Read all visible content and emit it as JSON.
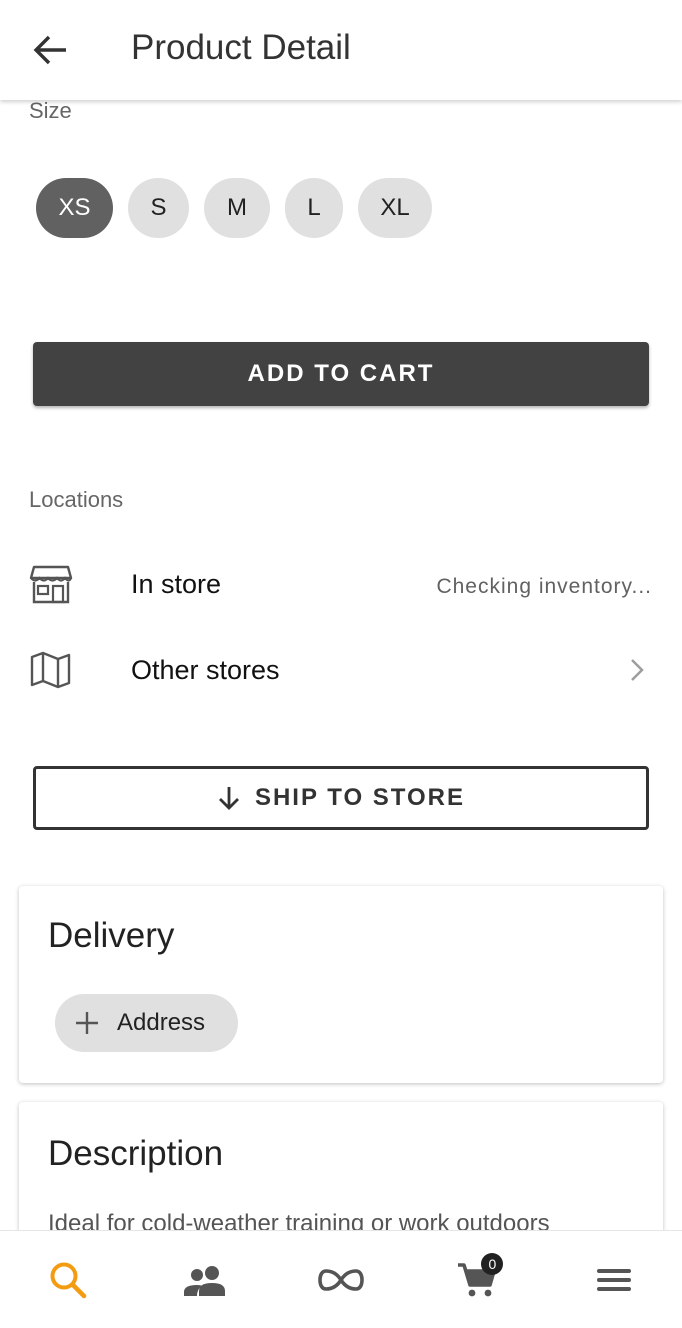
{
  "header": {
    "title": "Product Detail"
  },
  "size": {
    "label": "Size",
    "options": [
      "XS",
      "S",
      "M",
      "L",
      "XL"
    ],
    "selected": "XS"
  },
  "actions": {
    "add_to_cart": "ADD TO CART",
    "ship_to_store": "SHIP TO STORE"
  },
  "locations": {
    "label": "Locations",
    "in_store": {
      "title": "In store",
      "status": "Checking inventory..."
    },
    "other_stores": {
      "title": "Other stores"
    }
  },
  "delivery": {
    "title": "Delivery",
    "address_label": "Address"
  },
  "description": {
    "title": "Description",
    "text": "Ideal for cold-weather training or work outdoors"
  },
  "bottom_nav": {
    "items": [
      "search",
      "people",
      "infinity",
      "cart",
      "menu"
    ],
    "cart_count": "0",
    "active_color": "#F39C12"
  },
  "colors": {
    "primary_dark": "#424242",
    "chip_bg": "#E0E0E0",
    "chip_selected": "#616161"
  }
}
